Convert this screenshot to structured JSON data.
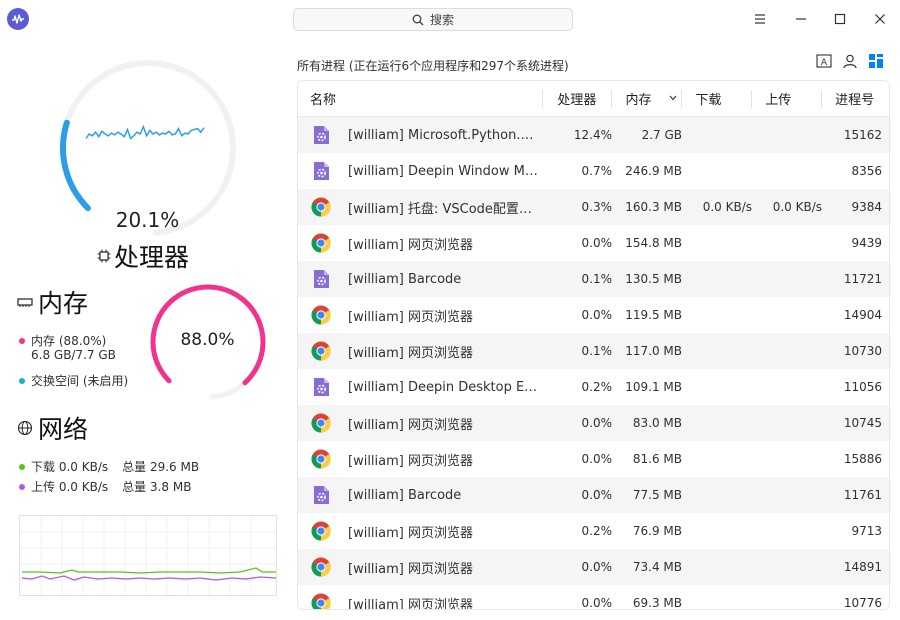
{
  "search": {
    "label": "搜索"
  },
  "cpu": {
    "percent_text": "20.1%",
    "usage_fraction": 0.201,
    "title": "处理器",
    "history": [
      0.55,
      0.6,
      0.58,
      0.62,
      0.57,
      0.63,
      0.6,
      0.58,
      0.61,
      0.59,
      0.62,
      0.6,
      0.57,
      0.65,
      0.55,
      0.58,
      0.62,
      0.6,
      0.68,
      0.58,
      0.64,
      0.6,
      0.62,
      0.59,
      0.61,
      0.6,
      0.63,
      0.59,
      0.6,
      0.66,
      0.58,
      0.61,
      0.6,
      0.64,
      0.65,
      0.66,
      0.62,
      0.67
    ]
  },
  "memory": {
    "title": "内存",
    "percent_text": "88.0%",
    "usage_fraction": 0.88,
    "legend_label": "内存 (88.0%)",
    "used_total": "6.8 GB/7.7 GB",
    "swap_label": "交换空间 (未启用)",
    "color": "#f0338e",
    "swap_color": "#19b2c9"
  },
  "network": {
    "title": "网络",
    "download_label": "下载 0.0 KB/s",
    "download_total": "总量 29.6 MB",
    "upload_label": "上传 0.0 KB/s",
    "upload_total": "总量 3.8 MB",
    "download_color": "#58c41a",
    "upload_color": "#b35be0"
  },
  "summary": "所有进程 (正在运行6个应用程序和297个系统进程)",
  "table": {
    "headers": {
      "name": "名称",
      "cpu": "处理器",
      "mem": "内存",
      "down": "下载",
      "up": "上传",
      "pid": "进程号"
    },
    "rows": [
      {
        "icon": "deepin-app-icon",
        "name": "[william] Microsoft.Python.…",
        "cpu": "12.4%",
        "mem": "2.7 GB",
        "down": "",
        "up": "",
        "pid": "15162"
      },
      {
        "icon": "deepin-app-icon",
        "name": "[william] Deepin Window M…",
        "cpu": "0.7%",
        "mem": "246.9 MB",
        "down": "",
        "up": "",
        "pid": "8356"
      },
      {
        "icon": "chrome-icon",
        "name": "[william] 托盘: VSCode配置…",
        "cpu": "0.3%",
        "mem": "160.3 MB",
        "down": "0.0 KB/s",
        "up": "0.0 KB/s",
        "pid": "9384"
      },
      {
        "icon": "chrome-icon",
        "name": "[william] 网页浏览器",
        "cpu": "0.0%",
        "mem": "154.8 MB",
        "down": "",
        "up": "",
        "pid": "9439"
      },
      {
        "icon": "deepin-app-icon",
        "name": "[william] Barcode",
        "cpu": "0.1%",
        "mem": "130.5 MB",
        "down": "",
        "up": "",
        "pid": "11721"
      },
      {
        "icon": "chrome-icon",
        "name": "[william] 网页浏览器",
        "cpu": "0.0%",
        "mem": "119.5 MB",
        "down": "",
        "up": "",
        "pid": "14904"
      },
      {
        "icon": "chrome-icon",
        "name": "[william] 网页浏览器",
        "cpu": "0.1%",
        "mem": "117.0 MB",
        "down": "",
        "up": "",
        "pid": "10730"
      },
      {
        "icon": "deepin-app-icon",
        "name": "[william] Deepin Desktop E…",
        "cpu": "0.2%",
        "mem": "109.1 MB",
        "down": "",
        "up": "",
        "pid": "11056"
      },
      {
        "icon": "chrome-icon",
        "name": "[william] 网页浏览器",
        "cpu": "0.0%",
        "mem": "83.0 MB",
        "down": "",
        "up": "",
        "pid": "10745"
      },
      {
        "icon": "chrome-icon",
        "name": "[william] 网页浏览器",
        "cpu": "0.0%",
        "mem": "81.6 MB",
        "down": "",
        "up": "",
        "pid": "15886"
      },
      {
        "icon": "deepin-app-icon",
        "name": "[william] Barcode",
        "cpu": "0.0%",
        "mem": "77.5 MB",
        "down": "",
        "up": "",
        "pid": "11761"
      },
      {
        "icon": "chrome-icon",
        "name": "[william] 网页浏览器",
        "cpu": "0.2%",
        "mem": "76.9 MB",
        "down": "",
        "up": "",
        "pid": "9713"
      },
      {
        "icon": "chrome-icon",
        "name": "[william] 网页浏览器",
        "cpu": "0.0%",
        "mem": "73.4 MB",
        "down": "",
        "up": "",
        "pid": "14891"
      },
      {
        "icon": "chrome-icon",
        "name": "[william] 网页浏览器",
        "cpu": "0.0%",
        "mem": "69.3 MB",
        "down": "",
        "up": "",
        "pid": "10776"
      }
    ]
  },
  "colors": {
    "cpu_ring": "#2e9de8",
    "cpu_line": "#2e9de8",
    "accent": "#0081ff"
  }
}
